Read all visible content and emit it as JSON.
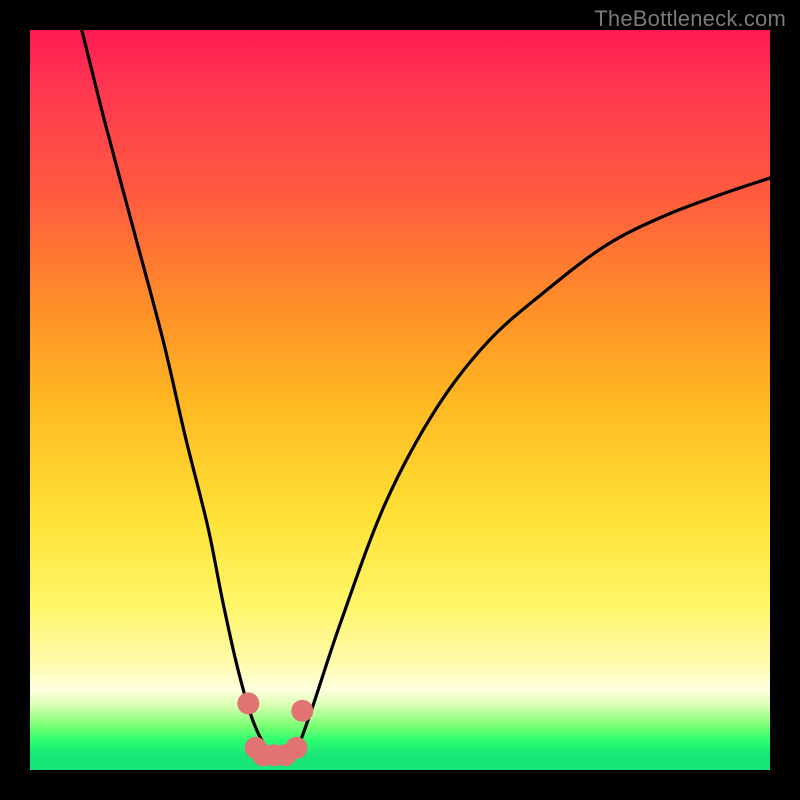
{
  "watermark": "TheBottleneck.com",
  "chart_data": {
    "type": "line",
    "title": "",
    "xlabel": "",
    "ylabel": "",
    "xlim": [
      0,
      100
    ],
    "ylim": [
      0,
      100
    ],
    "series": [
      {
        "name": "bottleneck-curve",
        "x": [
          7,
          10,
          14,
          18,
          21,
          24,
          26,
          28,
          30,
          32,
          34,
          36,
          38,
          42,
          48,
          55,
          62,
          70,
          78,
          86,
          94,
          100
        ],
        "values": [
          100,
          88,
          73,
          58,
          45,
          33,
          23,
          14,
          7,
          3,
          2,
          3,
          8,
          20,
          36,
          49,
          58,
          65,
          71,
          75,
          78,
          80
        ]
      }
    ],
    "markers": [
      {
        "name": "left-marker-top",
        "x": 29.5,
        "y": 9
      },
      {
        "name": "left-marker-bottom",
        "x": 30.5,
        "y": 3
      },
      {
        "name": "base-a",
        "x": 31.5,
        "y": 2
      },
      {
        "name": "base-b",
        "x": 33.0,
        "y": 2
      },
      {
        "name": "base-c",
        "x": 34.5,
        "y": 2
      },
      {
        "name": "right-marker-bottom",
        "x": 36.0,
        "y": 3
      },
      {
        "name": "right-marker-top",
        "x": 36.8,
        "y": 8
      }
    ],
    "marker_color": "#e27373",
    "curve_color": "#000000"
  }
}
